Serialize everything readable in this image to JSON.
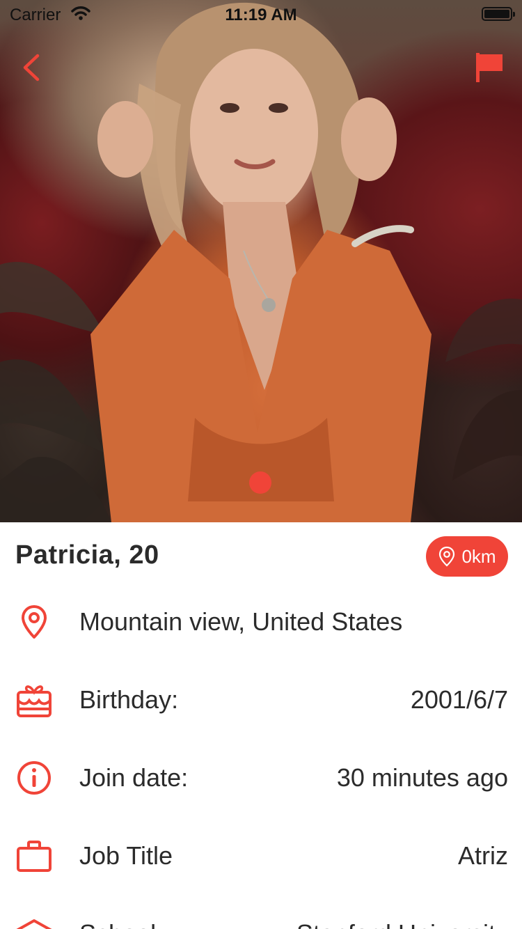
{
  "status_bar": {
    "carrier": "Carrier",
    "time": "11:19 AM"
  },
  "colors": {
    "accent": "#f04438",
    "text": "#2b2b2b"
  },
  "photo": {
    "page_count": 1,
    "current_page": 1
  },
  "profile": {
    "name_age": "Patricia, 20",
    "distance": "0km"
  },
  "details": [
    {
      "icon": "location-pin-icon",
      "label": "Mountain view, United States",
      "value": ""
    },
    {
      "icon": "birthday-cake-icon",
      "label": "Birthday:",
      "value": "2001/6/7"
    },
    {
      "icon": "info-icon",
      "label": "Join date:",
      "value": "30 minutes ago"
    },
    {
      "icon": "briefcase-icon",
      "label": "Job Title",
      "value": "Atriz"
    },
    {
      "icon": "school-icon",
      "label": "School",
      "value": "Stanford University"
    }
  ]
}
